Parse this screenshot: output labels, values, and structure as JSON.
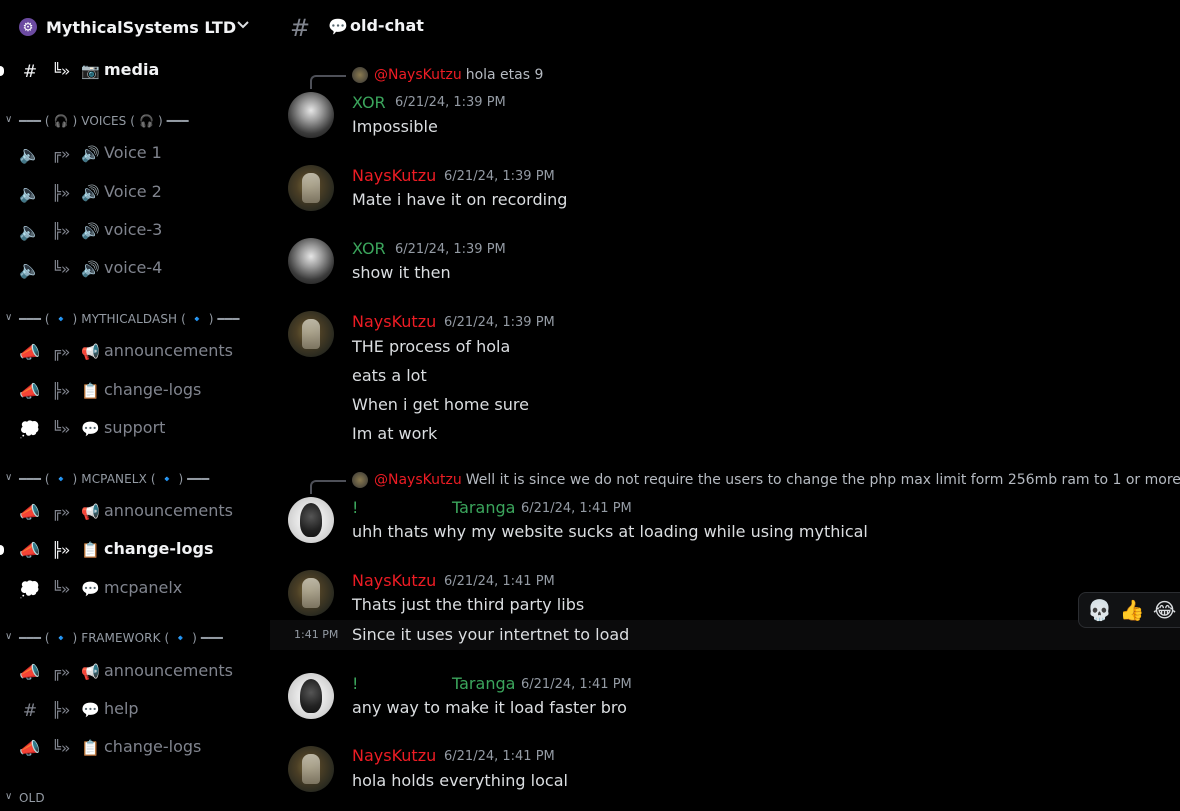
{
  "server": {
    "name": "MythicalSystems LTD",
    "icon": "⚙"
  },
  "sidebar": {
    "channels": [
      {
        "label": "media",
        "emoji": "📷",
        "icon": "hash-thread-icon",
        "active": true,
        "unread": true
      },
      {
        "label": "Voice 1",
        "emoji": "🔊",
        "icon": "voice-icon"
      },
      {
        "label": "Voice 2",
        "emoji": "🔊",
        "icon": "voice-icon"
      },
      {
        "label": "voice-3",
        "emoji": "🔊",
        "icon": "voice-icon"
      },
      {
        "label": "voice-4",
        "emoji": "🔊",
        "icon": "voice-icon"
      },
      {
        "label": "announcements",
        "emoji": "📢",
        "icon": "megaphone-icon"
      },
      {
        "label": "change-logs",
        "emoji": "📋",
        "icon": "megaphone-icon"
      },
      {
        "label": "support",
        "emoji": "💬",
        "icon": "forum-icon"
      },
      {
        "label": "announcements",
        "emoji": "📢",
        "icon": "megaphone-icon"
      },
      {
        "label": "change-logs",
        "emoji": "📋",
        "icon": "megaphone-icon",
        "active": true,
        "unread": true
      },
      {
        "label": "mcpanelx",
        "emoji": "💬",
        "icon": "forum-icon"
      },
      {
        "label": "announcements",
        "emoji": "📢",
        "icon": "megaphone-icon"
      },
      {
        "label": "help",
        "emoji": "💬",
        "icon": "hash-icon"
      },
      {
        "label": "change-logs",
        "emoji": "📋",
        "icon": "megaphone-icon"
      }
    ],
    "categories": [
      {
        "label": "━━━ ( 🎧 ) VOICES ( 🎧 ) ━━━"
      },
      {
        "label": "━━━ ( 🔹 ) MYTHICALDASH ( 🔹 ) ━━━"
      },
      {
        "label": "━━━ ( 🔹 ) MCPANELX ( 🔹 ) ━━━"
      },
      {
        "label": "━━━ ( 🔹 ) FRAMEWORK ( 🔹 ) ━━━"
      },
      {
        "label": "OLD"
      }
    ]
  },
  "channel": {
    "emoji": "💬",
    "name": "old-chat"
  },
  "messages": {
    "reply1": {
      "name": "@NaysKutzu",
      "text": "hola etas 9"
    },
    "m1": {
      "author": "XOR",
      "time": "6/21/24, 1:39 PM",
      "lines": [
        "Impossible"
      ]
    },
    "m2": {
      "author": "NaysKutzu",
      "time": "6/21/24, 1:39 PM",
      "lines": [
        "Mate i have it on recording"
      ]
    },
    "m3": {
      "author": "XOR",
      "time": "6/21/24, 1:39 PM",
      "lines": [
        "show it then"
      ]
    },
    "m4": {
      "author": "NaysKutzu",
      "time": "6/21/24, 1:39 PM",
      "lines": [
        "THE process of hola",
        "eats a lot",
        "When i get home sure",
        "Im at work"
      ]
    },
    "reply2": {
      "name": "@NaysKutzu",
      "text": "Well it is since we do not require the users to change the php max limit form 256mb ram to 1 or more"
    },
    "m5": {
      "bang": "!",
      "author": "Taranga",
      "time": "6/21/24, 1:41 PM",
      "lines": [
        "uhh thats why my website sucks at loading while using mythical"
      ]
    },
    "m6": {
      "author": "NaysKutzu",
      "time": "6/21/24, 1:41 PM",
      "lines": [
        "Thats just the third party libs"
      ]
    },
    "m6b": {
      "hover_time": "1:41 PM",
      "line": "Since it uses your intertnet to load"
    },
    "m7": {
      "bang": "!",
      "author": "Taranga",
      "time": "6/21/24, 1:41 PM",
      "lines": [
        "any way to make it load faster bro"
      ]
    },
    "m8": {
      "author": "NaysKutzu",
      "time": "6/21/24, 1:41 PM",
      "lines": [
        "hola holds everything local"
      ]
    }
  },
  "reactions": [
    "💀",
    "👍",
    "😂"
  ]
}
